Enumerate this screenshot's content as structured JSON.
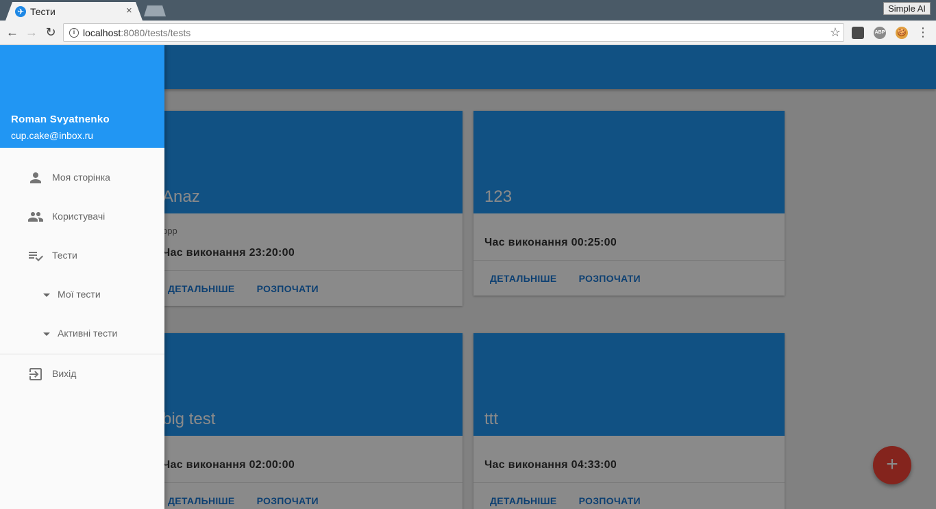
{
  "browser": {
    "tab_title": "Тести",
    "tab_close": "×",
    "profile_label": "Simple AI",
    "url_host": "localhost",
    "url_rest": ":8080/tests/tests",
    "back_icon": "←",
    "forward_icon": "→",
    "reload_icon": "↻",
    "info_icon": "i",
    "star_icon": "☆",
    "menu_icon": "⋮",
    "extensions": [
      {
        "name": "lastpass-icon",
        "label": "",
        "color": "#4a4a4a"
      },
      {
        "name": "adblock-icon",
        "label": "ABP",
        "color": "#8a8a8a"
      },
      {
        "name": "cookie-icon",
        "label": "🍪",
        "color": "#e0a040"
      }
    ]
  },
  "drawer": {
    "user_name": "Roman Svyatnenko",
    "user_email": "cup.cake@inbox.ru",
    "items": [
      {
        "label": "Моя сторінка"
      },
      {
        "label": "Користувачі"
      },
      {
        "label": "Тести"
      },
      {
        "label": "Мої тести"
      },
      {
        "label": "Активні тести"
      },
      {
        "label": "Вихід"
      }
    ]
  },
  "cards": [
    {
      "title": "Anaz",
      "subtitle": "ppp",
      "time": "Час виконання 23:20:00",
      "details": "ДЕТАЛЬНІШЕ",
      "start": "РОЗПОЧАТИ"
    },
    {
      "title": "123",
      "subtitle": "",
      "time": "Час виконання 00:25:00",
      "details": "ДЕТАЛЬНІШЕ",
      "start": "РОЗПОЧАТИ"
    },
    {
      "title": "big test",
      "subtitle": "",
      "time": "Час виконання 02:00:00",
      "details": "ДЕТАЛЬНІШЕ",
      "start": "РОЗПОЧАТИ"
    },
    {
      "title": "ttt",
      "subtitle": "",
      "time": "Час виконання 04:33:00",
      "details": "ДЕТАЛЬНІШЕ",
      "start": "РОЗПОЧАТИ"
    }
  ],
  "fab_label": "+",
  "colors": {
    "primary": "#2196f3",
    "accent": "#f44336",
    "button_text": "#1976d2"
  }
}
